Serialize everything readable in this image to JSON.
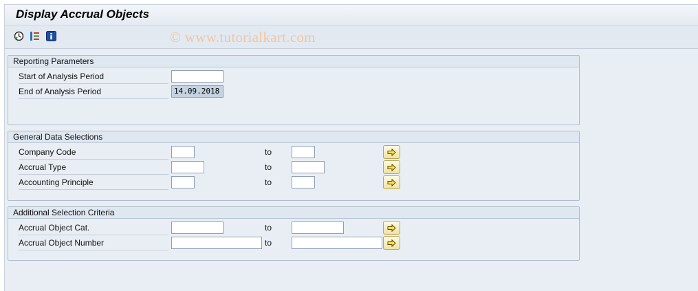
{
  "window": {
    "title": "Display Accrual Objects"
  },
  "toolbar": {
    "execute_icon": "execute-clock-icon",
    "variant_icon": "variant-list-icon",
    "info_icon": "info-icon"
  },
  "watermark": "© www.tutorialkart.com",
  "reporting_parameters": {
    "heading": "Reporting Parameters",
    "start_label": "Start of Analysis Period",
    "start_value": "",
    "end_label": "End of Analysis Period",
    "end_value": "14.09.2018"
  },
  "general_selections": {
    "heading": "General Data Selections",
    "to_label": "to",
    "rows": [
      {
        "label": "Company Code",
        "from": "",
        "to": ""
      },
      {
        "label": "Accrual Type",
        "from": "",
        "to": ""
      },
      {
        "label": "Accounting Principle",
        "from": "",
        "to": ""
      }
    ]
  },
  "additional_selections": {
    "heading": "Additional Selection Criteria",
    "to_label": "to",
    "rows": [
      {
        "label": "Accrual Object Cat.",
        "from": "",
        "to": ""
      },
      {
        "label": "Accrual Object Number",
        "from": "",
        "to": ""
      }
    ]
  },
  "colors": {
    "accent_button": "#efe2a8",
    "background": "#e9eef4",
    "arrow": "#5a4a00"
  }
}
